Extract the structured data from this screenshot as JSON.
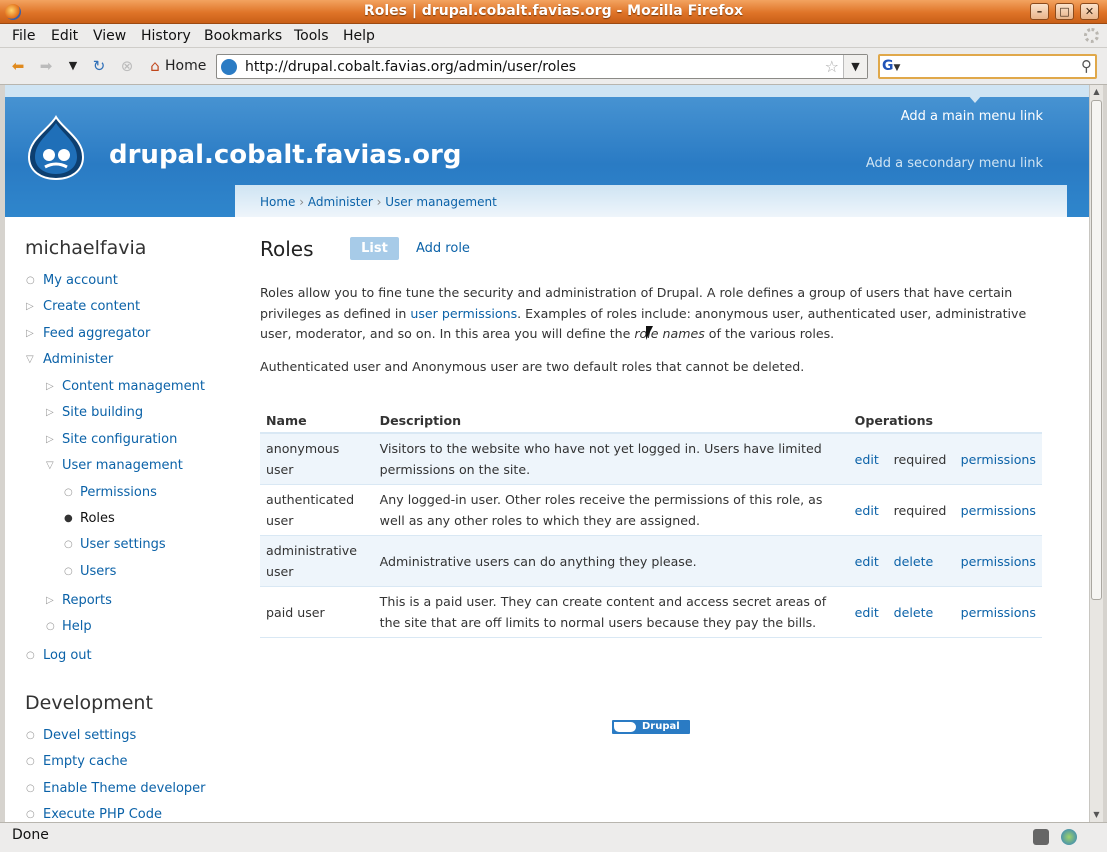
{
  "window": {
    "title": "Roles | drupal.cobalt.favias.org - Mozilla Firefox"
  },
  "menubar": {
    "items": [
      "File",
      "Edit",
      "View",
      "History",
      "Bookmarks",
      "Tools",
      "Help"
    ]
  },
  "navbar": {
    "home_label": "Home",
    "url": "http://drupal.cobalt.favias.org/admin/user/roles",
    "search_engine": "G",
    "search_value": ""
  },
  "status": {
    "text": "Done"
  },
  "header": {
    "site_name": "drupal.cobalt.favias.org",
    "primary_link": "Add a main menu link",
    "secondary_link": "Add a secondary menu link"
  },
  "sidebar": {
    "user_name": "michaelfavia",
    "items": [
      {
        "label": "My account"
      },
      {
        "label": "Create content"
      },
      {
        "label": "Feed aggregator"
      },
      {
        "label": "Administer"
      },
      {
        "label": "Content management"
      },
      {
        "label": "Site building"
      },
      {
        "label": "Site configuration"
      },
      {
        "label": "User management"
      },
      {
        "label": "Permissions"
      },
      {
        "label": "Roles"
      },
      {
        "label": "User settings"
      },
      {
        "label": "Users"
      },
      {
        "label": "Reports"
      },
      {
        "label": "Help"
      },
      {
        "label": "Log out"
      }
    ],
    "dev_title": "Development",
    "dev_items": [
      {
        "label": "Devel settings"
      },
      {
        "label": "Empty cache"
      },
      {
        "label": "Enable Theme developer"
      },
      {
        "label": "Execute PHP Code"
      }
    ]
  },
  "breadcrumb": {
    "items": [
      "Home",
      "Administer",
      "User management"
    ],
    "separator": "›"
  },
  "page": {
    "title": "Roles",
    "tab_list": "List",
    "tab_add": "Add role",
    "help_part1": "Roles allow you to fine tune the security and administration of Drupal. A role defines a group of users that have certain privileges as defined in ",
    "help_link": "user permissions",
    "help_part2": ". Examples of roles include: anonymous user, authenticated user, administrative user, moderator, and so on. In this area you will define the ",
    "help_em": "role names",
    "help_part3": " of the various roles.",
    "note": "Authenticated user and Anonymous user are two default roles that cannot be deleted."
  },
  "table": {
    "headers": [
      "Name",
      "Description",
      "Operations"
    ],
    "rows": [
      {
        "name": "anonymous user",
        "description": "Visitors to the website who have not yet logged in. Users have limited permissions on the site.",
        "op1": "edit",
        "op2": "required",
        "op3": "permissions"
      },
      {
        "name": "authenticated user",
        "description": "Any logged-in user. Other roles receive the permissions of this role, as well as any other roles to which they are assigned.",
        "op1": "edit",
        "op2": "required",
        "op3": "permissions"
      },
      {
        "name": "administrative user",
        "description": "Administrative users can do anything they please.",
        "op1": "edit",
        "op2": "delete",
        "op3": "permissions"
      },
      {
        "name": "paid user",
        "description": "This is a paid user. They can create content and access secret areas of the site that are off limits to normal users because they pay the bills.",
        "op1": "edit",
        "op2": "delete",
        "op3": "permissions"
      }
    ]
  },
  "footer": {
    "badge_text": "Drupal"
  },
  "colors": {
    "brand_blue": "#2a7bc4",
    "link": "#0b62a8",
    "titlebar_orange": "#df7428"
  }
}
